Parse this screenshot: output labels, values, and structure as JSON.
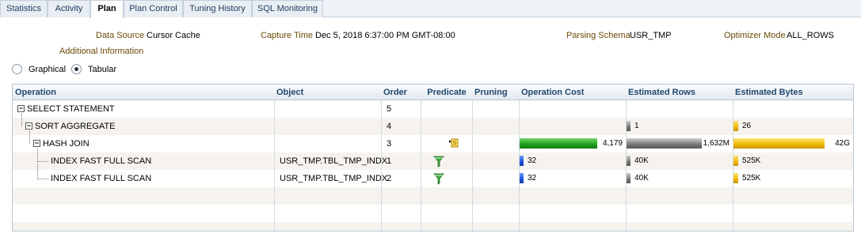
{
  "tabs": [
    {
      "label": "Statistics"
    },
    {
      "label": "Activity"
    },
    {
      "label": "Plan"
    },
    {
      "label": "Plan Control"
    },
    {
      "label": "Tuning History"
    },
    {
      "label": "SQL Monitoring"
    }
  ],
  "info": {
    "data_source_label": "Data Source",
    "data_source_value": "Cursor Cache",
    "capture_time_label": "Capture Time",
    "capture_time_value": "Dec 5, 2018 6:37:00 PM GMT-08:00",
    "parsing_schema_label": "Parsing Schema",
    "parsing_schema_value": "USR_TMP",
    "optimizer_mode_label": "Optimizer Mode",
    "optimizer_mode_value": "ALL_ROWS",
    "additional_info_label": "Additional Information"
  },
  "view_mode": {
    "graphical_label": "Graphical",
    "tabular_label": "Tabular",
    "selected": "Tabular"
  },
  "table": {
    "headers": {
      "operation": "Operation",
      "object": "Object",
      "order": "Order",
      "predicate": "Predicate",
      "pruning": "Pruning",
      "operation_cost": "Operation Cost",
      "estimated_rows": "Estimated Rows",
      "estimated_bytes": "Estimated Bytes"
    },
    "rows": [
      {
        "operation": "SELECT STATEMENT",
        "object": "",
        "order": "5",
        "predicate_icon": "",
        "cost": "",
        "cost_fraction": 0,
        "rows": "",
        "rows_fraction": 0,
        "bytes": "",
        "bytes_fraction": 0
      },
      {
        "operation": "SORT AGGREGATE",
        "object": "",
        "order": "4",
        "predicate_icon": "",
        "cost": "",
        "cost_fraction": 0,
        "rows": "1",
        "rows_fraction": 0.05,
        "bytes": "26",
        "bytes_fraction": 0.05
      },
      {
        "operation": "HASH JOIN",
        "object": "",
        "order": "3",
        "predicate_icon": "note-icon",
        "cost": "4,179",
        "cost_fraction": 1.0,
        "rows": "1,632M",
        "rows_fraction": 1.0,
        "bytes": "42G",
        "bytes_fraction": 1.0
      },
      {
        "operation": "INDEX FAST FULL SCAN",
        "object": "USR_TMP.TBL_TMP_INDX",
        "order": "1",
        "predicate_icon": "filter-funnel-icon",
        "cost": "32",
        "cost_fraction": 0.05,
        "rows": "40K",
        "rows_fraction": 0.05,
        "bytes": "525K",
        "bytes_fraction": 0.05
      },
      {
        "operation": "INDEX FAST FULL SCAN",
        "object": "USR_TMP.TBL_TMP_INDX",
        "order": "2",
        "predicate_icon": "filter-funnel-icon",
        "cost": "32",
        "cost_fraction": 0.05,
        "rows": "40K",
        "rows_fraction": 0.05,
        "bytes": "525K",
        "bytes_fraction": 0.05
      }
    ]
  },
  "colors": {
    "cost_bar": "#1d9e1d",
    "rows_bar": "#777777",
    "bytes_bar": "#f1b800",
    "small_cost_bar": "#1f4fd8"
  }
}
